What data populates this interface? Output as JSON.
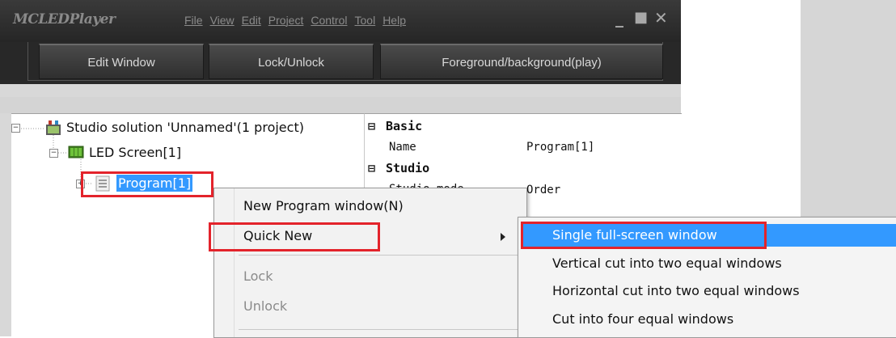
{
  "app": {
    "title": "MCLEDPlayer"
  },
  "menu": [
    "File",
    "View",
    "Edit",
    "Project",
    "Control",
    "Tool",
    "Help"
  ],
  "window_controls": {
    "minimize": "_",
    "maximize": "■",
    "close": "✕"
  },
  "toolbar": {
    "edit_window": "Edit Window",
    "lock_unlock": "Lock/Unlock",
    "foreground_background": "Foreground/background(play)"
  },
  "tree": {
    "expanders": {
      "solution": "−",
      "screen": "−",
      "program": "+"
    },
    "solution": "Studio solution 'Unnamed'(1 project)",
    "screen": "LED Screen[1]",
    "program": "Program[1]"
  },
  "properties": {
    "toggle": "⊟",
    "basic_header": "Basic",
    "name_key": "Name",
    "name_value": "Program[1]",
    "studio_header": "Studio",
    "studio_key_partial": "Studio mode",
    "studio_value": "Order"
  },
  "context_menu": {
    "new_program_window": "New Program window(N)",
    "quick_new": "Quick New",
    "lock": "Lock",
    "unlock": "Unlock"
  },
  "submenu": [
    "Single full-screen window",
    "Vertical cut into two equal windows",
    "Horizontal cut into two equal windows",
    "Cut into four equal windows"
  ],
  "colors": {
    "highlight": "#3399ff",
    "annotation_red": "#e3232b",
    "titlebar": "#2a2a2a"
  }
}
